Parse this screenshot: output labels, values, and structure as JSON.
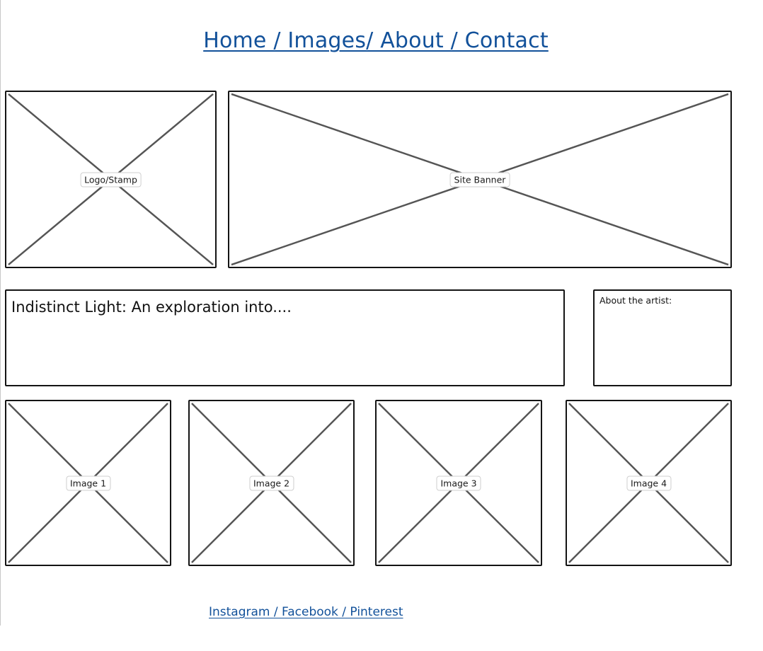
{
  "nav": {
    "label": "Home / Images/ About / Contact"
  },
  "header": {
    "logo_label": "Logo/Stamp",
    "banner_label": "Site Banner"
  },
  "intro": {
    "headline": "Indistinct Light: An exploration into...."
  },
  "about": {
    "label": "About the artist:"
  },
  "gallery": {
    "images": [
      {
        "label": "Image 1"
      },
      {
        "label": "Image 2"
      },
      {
        "label": "Image 3"
      },
      {
        "label": "Image 4"
      }
    ]
  },
  "footer": {
    "social_label": "Instagram / Facebook / Pinterest"
  },
  "colors": {
    "link": "#12519a",
    "border": "#141414",
    "cross": "#555555"
  }
}
